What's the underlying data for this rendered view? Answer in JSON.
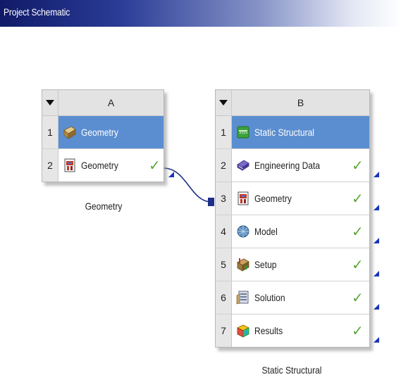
{
  "header": {
    "title": "Project Schematic"
  },
  "systems": [
    {
      "letter": "A",
      "caption": "Geometry",
      "rows": [
        {
          "num": "1",
          "label": "Geometry",
          "icon": "geometry-box-icon",
          "status": ""
        },
        {
          "num": "2",
          "label": "Geometry",
          "icon": "geometry-cell-icon",
          "status": "up-to-date"
        }
      ]
    },
    {
      "letter": "B",
      "caption": "Static Structural",
      "rows": [
        {
          "num": "1",
          "label": "Static Structural",
          "icon": "static-structural-icon",
          "status": ""
        },
        {
          "num": "2",
          "label": "Engineering Data",
          "icon": "engineering-data-icon",
          "status": "up-to-date"
        },
        {
          "num": "3",
          "label": "Geometry",
          "icon": "geometry-cell-icon",
          "status": "up-to-date"
        },
        {
          "num": "4",
          "label": "Model",
          "icon": "model-icon",
          "status": "up-to-date"
        },
        {
          "num": "5",
          "label": "Setup",
          "icon": "setup-icon",
          "status": "up-to-date"
        },
        {
          "num": "6",
          "label": "Solution",
          "icon": "solution-icon",
          "status": "up-to-date"
        },
        {
          "num": "7",
          "label": "Results",
          "icon": "results-icon",
          "status": "up-to-date"
        }
      ]
    }
  ],
  "connection": {
    "from": "A2",
    "to": "B3"
  },
  "colors": {
    "title_bar": "#101a68",
    "selected_row": "#5b8ed0",
    "check": "#5aa83a",
    "connector": "#1c2f8a"
  }
}
